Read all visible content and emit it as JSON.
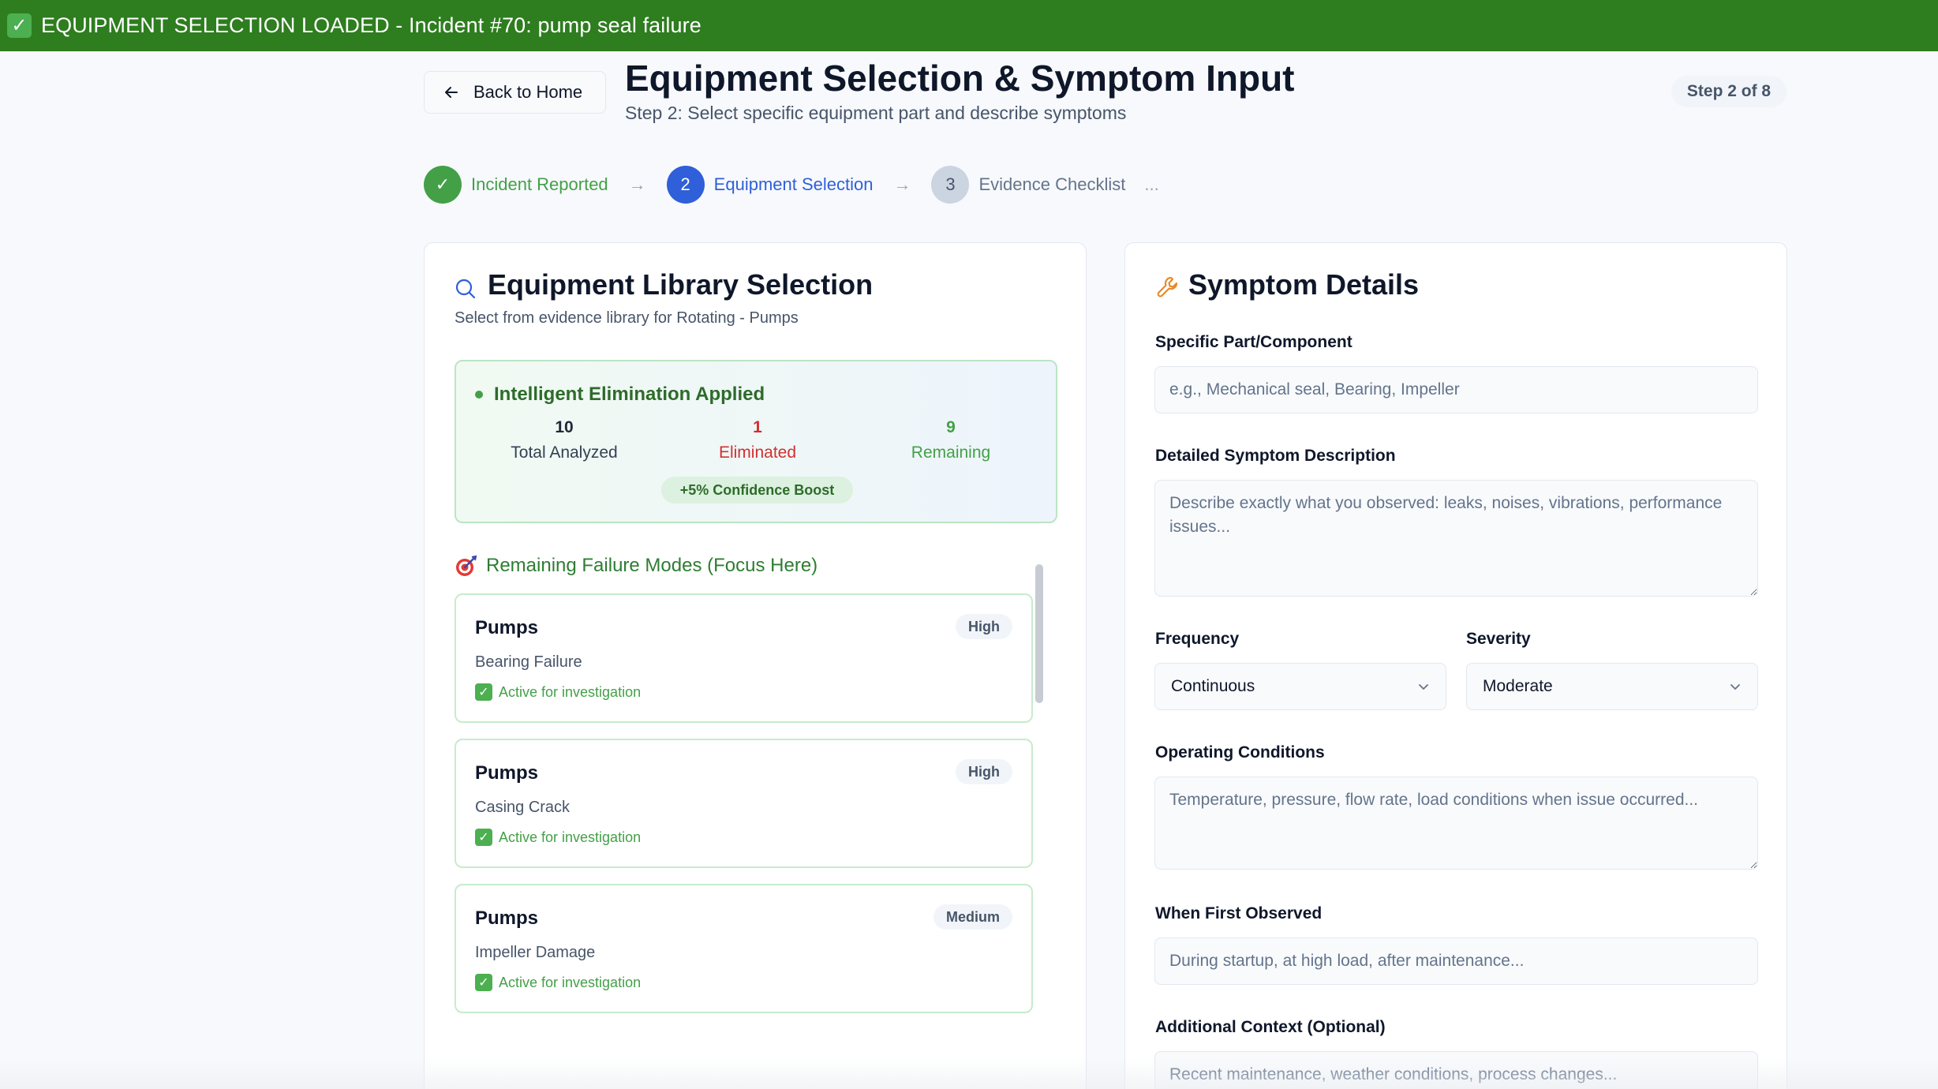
{
  "banner": {
    "text": "EQUIPMENT SELECTION LOADED - Incident #70: pump seal failure",
    "icon": "check-mark-icon"
  },
  "header": {
    "back_label": "Back to Home",
    "title": "Equipment Selection & Symptom Input",
    "subtitle": "Step 2: Select specific equipment part and describe symptoms",
    "step_badge": "Step 2 of 8"
  },
  "stepper": {
    "steps": [
      {
        "number": "✓",
        "label": "Incident Reported",
        "state": "done"
      },
      {
        "number": "2",
        "label": "Equipment Selection",
        "state": "active"
      },
      {
        "number": "3",
        "label": "Evidence Checklist",
        "state": "pending"
      }
    ],
    "more": "..."
  },
  "library": {
    "title": "Equipment Library Selection",
    "subtitle": "Select from evidence library for Rotating - Pumps",
    "elimination": {
      "title": "Intelligent Elimination Applied",
      "stats": [
        {
          "value": "10",
          "label": "Total Analyzed",
          "color": "#1f2937"
        },
        {
          "value": "1",
          "label": "Eliminated",
          "color": "#d32f2f"
        },
        {
          "value": "9",
          "label": "Remaining",
          "color": "#43a047"
        }
      ],
      "boost": "+5% Confidence Boost"
    },
    "modes_title": "Remaining Failure Modes (Focus Here)",
    "modes": [
      {
        "equipment": "Pumps",
        "failure_mode": "Bearing Failure",
        "status": "Active for investigation",
        "priority": "High"
      },
      {
        "equipment": "Pumps",
        "failure_mode": "Casing Crack",
        "status": "Active for investigation",
        "priority": "High"
      },
      {
        "equipment": "Pumps",
        "failure_mode": "Impeller Damage",
        "status": "Active for investigation",
        "priority": "Medium"
      }
    ]
  },
  "symptoms": {
    "title": "Symptom Details",
    "part_label": "Specific Part/Component",
    "part_placeholder": "e.g., Mechanical seal, Bearing, Impeller",
    "description_label": "Detailed Symptom Description",
    "description_placeholder": "Describe exactly what you observed: leaks, noises, vibrations, performance issues...",
    "frequency_label": "Frequency",
    "frequency_value": "Continuous",
    "severity_label": "Severity",
    "severity_value": "Moderate",
    "conditions_label": "Operating Conditions",
    "conditions_placeholder": "Temperature, pressure, flow rate, load conditions when issue occurred...",
    "first_observed_label": "When First Observed",
    "first_observed_placeholder": "During startup, at high load, after maintenance...",
    "context_label": "Additional Context (Optional)",
    "context_placeholder": "Recent maintenance, weather conditions, process changes..."
  }
}
